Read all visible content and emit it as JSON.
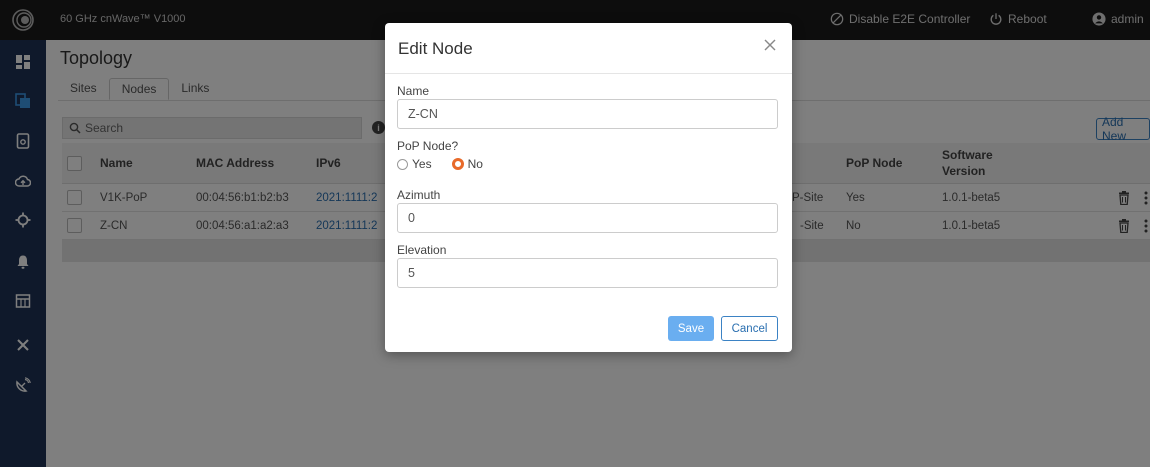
{
  "app": {
    "title": "60 GHz cnWave™ V1000",
    "disable_controller_label": "Disable E2E Controller",
    "reboot_label": "Reboot",
    "user_label": "admin"
  },
  "sidebar": {
    "items": [
      {
        "icon": "dashboard-icon"
      },
      {
        "icon": "topology-icon",
        "active": true
      },
      {
        "icon": "report-icon"
      },
      {
        "icon": "cloud-upload-icon"
      },
      {
        "icon": "crosshair-icon"
      },
      {
        "icon": "bell-icon"
      },
      {
        "icon": "table-icon"
      },
      {
        "icon": "tools-icon"
      },
      {
        "icon": "satellite-dish-icon"
      }
    ]
  },
  "page": {
    "title": "Topology",
    "tabs": [
      {
        "label": "Sites",
        "active": false
      },
      {
        "label": "Nodes",
        "active": true
      },
      {
        "label": "Links",
        "active": false
      }
    ],
    "search_placeholder": "Search",
    "info_icon_glyph": "i",
    "add_new_label": "Add New"
  },
  "table": {
    "columns": {
      "name": "Name",
      "mac": "MAC Address",
      "ipv6": "IPv6",
      "pop": "PoP Node",
      "software_line1": "Software",
      "software_line2": "Version"
    },
    "rows": [
      {
        "name": "V1K-PoP",
        "mac": "00:04:56:b1:b2:b3",
        "ipv6": "2021:1111:2",
        "site": "P-Site",
        "pop": "Yes",
        "software": "1.0.1-beta5"
      },
      {
        "name": "Z-CN",
        "mac": "00:04:56:a1:a2:a3",
        "ipv6": "2021:1111:2",
        "site": "-Site",
        "pop": "No",
        "software": "1.0.1-beta5"
      }
    ]
  },
  "modal": {
    "title": "Edit Node",
    "name_label": "Name",
    "name_value": "Z-CN",
    "pop_label": "PoP Node?",
    "pop_yes": "Yes",
    "pop_no": "No",
    "pop_selected": "No",
    "azimuth_label": "Azimuth",
    "azimuth_value": "0",
    "elevation_label": "Elevation",
    "elevation_value": "5",
    "save_label": "Save",
    "cancel_label": "Cancel"
  },
  "colors": {
    "sidebar_bg": "#1e3356",
    "topbar_bg": "#1b1b1b",
    "accent_blue": "#2a6fb0",
    "save_button": "#6aaef0",
    "radio_checked": "#e86a2a"
  }
}
